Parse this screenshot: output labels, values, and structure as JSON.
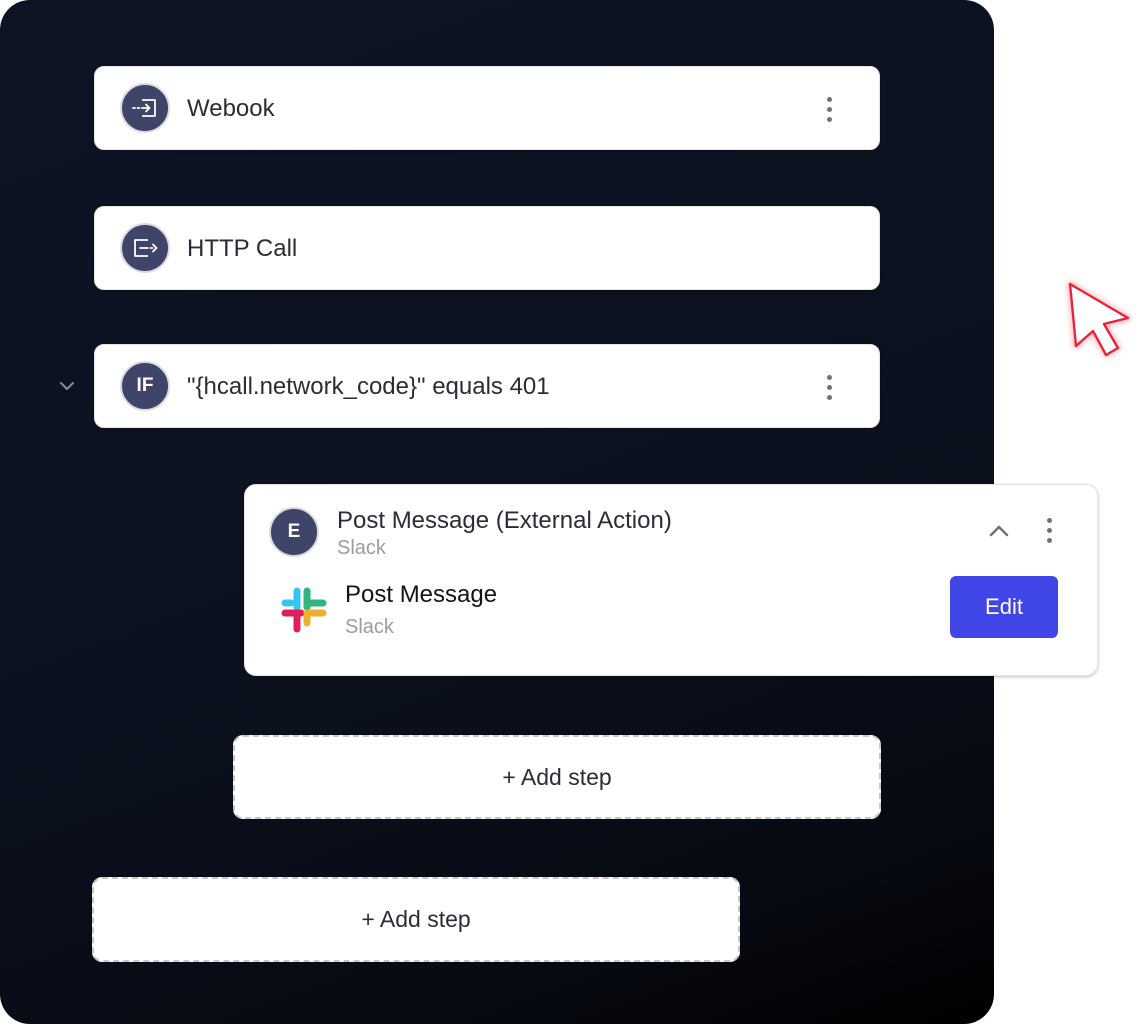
{
  "steps": [
    {
      "title": "Webook",
      "icon": "webhook-icon"
    },
    {
      "title": "HTTP Call",
      "icon": "http-call-icon"
    },
    {
      "title": "\"{hcall.network_code}\" equals 401",
      "badge": "IF"
    }
  ],
  "action": {
    "badge": "E",
    "title": "Post Message (External Action)",
    "subtitle": "Slack",
    "item_title": "Post Message",
    "item_subtitle": "Slack",
    "edit_label": "Edit"
  },
  "add_step_nested": "+ Add step",
  "add_step_root": "+ Add step",
  "colors": {
    "panel_bg": "#0b111e",
    "avatar_bg": "#3f4469",
    "edit_button": "#4047e6",
    "cursor_accent": "#e8213a"
  }
}
